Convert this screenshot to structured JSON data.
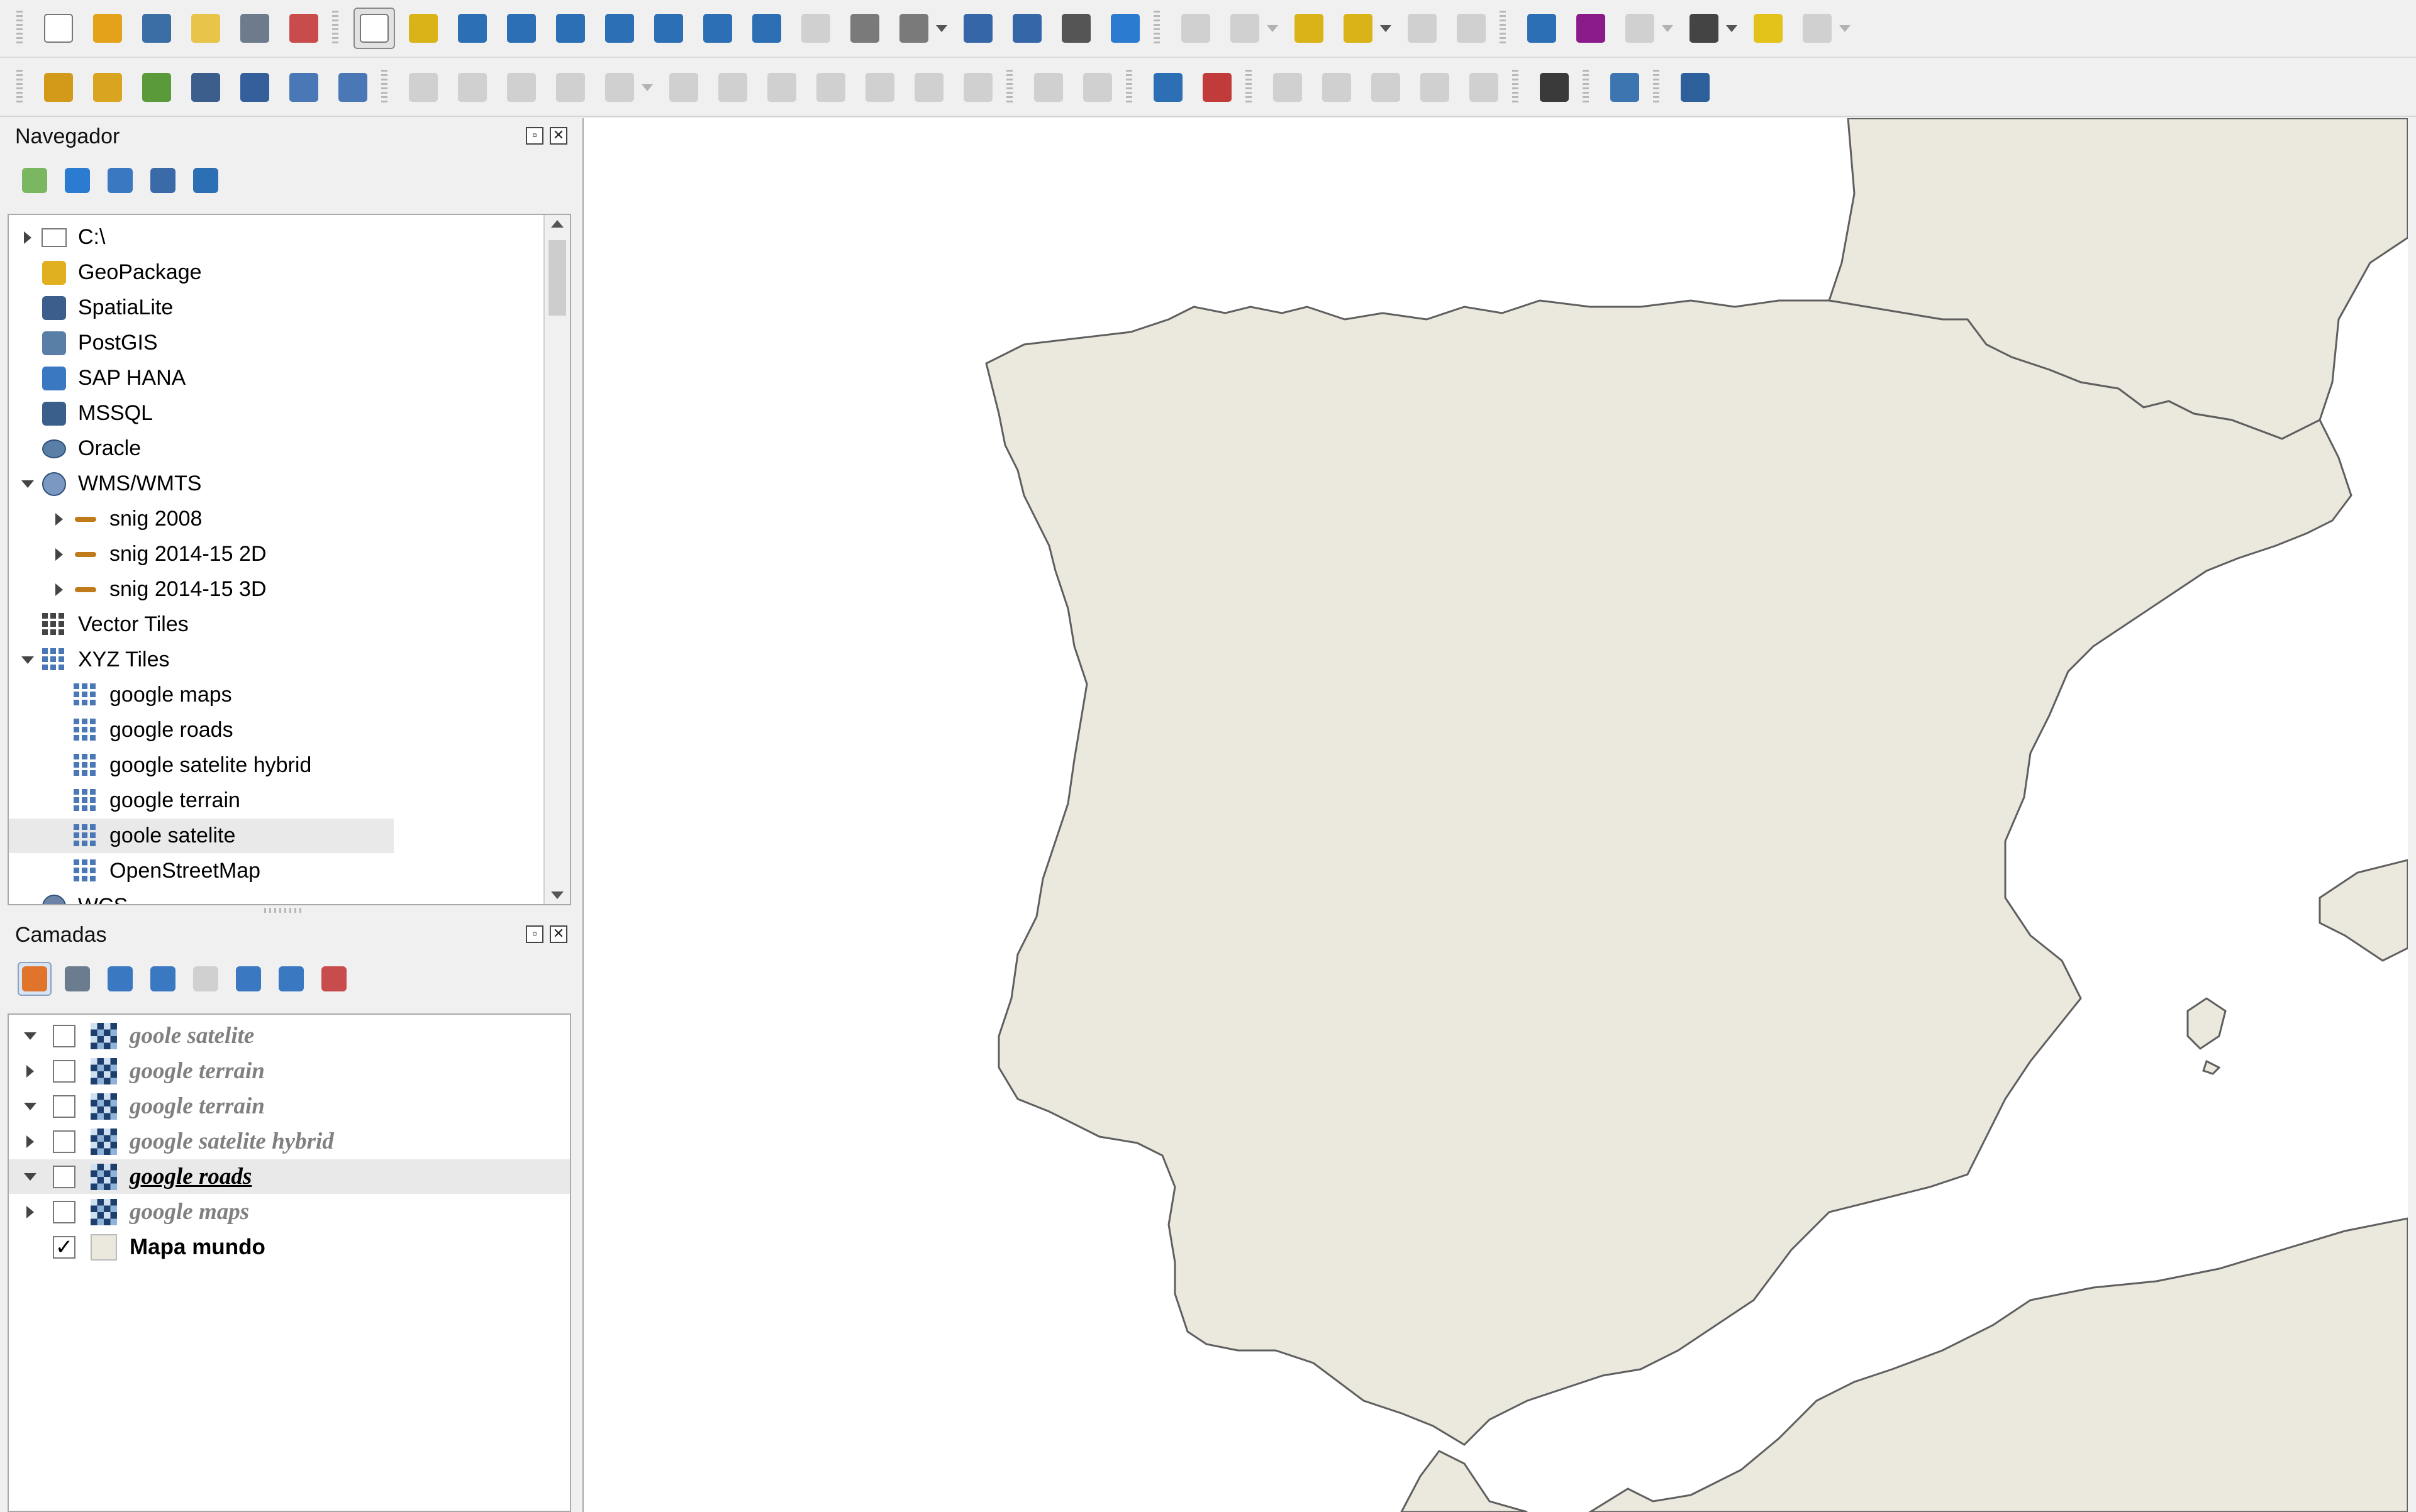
{
  "colors": {
    "land": "#ebe8dd",
    "border": "#5f5f5f",
    "sea": "#ffffff",
    "toolbar_bg": "#f0f0f0"
  },
  "toolbar1": [
    {
      "name": "new-project-icon",
      "color": "#ffffff"
    },
    {
      "name": "open-project-icon",
      "color": "#e3a21a"
    },
    {
      "name": "save-project-icon",
      "color": "#3a6ea5"
    },
    {
      "name": "new-print-layout-icon",
      "color": "#e8c44a"
    },
    {
      "name": "layout-manager-icon",
      "color": "#6d7b8d"
    },
    {
      "name": "style-manager-icon",
      "color": "#c94c4c"
    },
    {
      "name": "pan-map-icon",
      "color": "#ffffff",
      "active": true
    },
    {
      "name": "pan-to-selection-icon",
      "color": "#d9b317"
    },
    {
      "name": "zoom-in-icon",
      "color": "#2d6fb4"
    },
    {
      "name": "zoom-out-icon",
      "color": "#2d6fb4"
    },
    {
      "name": "zoom-full-icon",
      "color": "#2d6fb4"
    },
    {
      "name": "zoom-to-selection-icon",
      "color": "#2d6fb4"
    },
    {
      "name": "zoom-to-layer-icon",
      "color": "#2d6fb4"
    },
    {
      "name": "zoom-native-icon",
      "color": "#2d6fb4"
    },
    {
      "name": "zoom-last-icon",
      "color": "#2d6fb4"
    },
    {
      "name": "zoom-next-icon",
      "color": "#9a9a9a",
      "disabled": true
    },
    {
      "name": "new-map-view-icon",
      "color": "#7a7a7a"
    },
    {
      "name": "new-3d-map-view-icon",
      "color": "#7a7a7a"
    },
    {
      "name": "new-bookmark-icon",
      "color": "#3466a8"
    },
    {
      "name": "show-bookmarks-icon",
      "color": "#3466a8"
    },
    {
      "name": "temporal-controller-icon",
      "color": "#555555"
    },
    {
      "name": "refresh-icon",
      "color": "#2b7bd0"
    },
    {
      "name": "identify-features-icon",
      "color": "#9a9a9a",
      "disabled": true
    },
    {
      "name": "select-features-icon",
      "color": "#9a9a9a",
      "disabled": true
    },
    {
      "name": "select-by-value-icon",
      "color": "#d9b317"
    },
    {
      "name": "deselect-icon",
      "color": "#d9b317"
    },
    {
      "name": "locate-icon",
      "color": "#9a9a9a",
      "disabled": true
    },
    {
      "name": "attribute-table-icon",
      "color": "#9a9a9a",
      "disabled": true
    },
    {
      "name": "processing-toolbox-icon",
      "color": "#2d6fb4"
    },
    {
      "name": "statistical-summary-icon",
      "color": "#8b1a8b"
    },
    {
      "name": "field-calculator-icon",
      "color": "#9a9a9a",
      "disabled": true
    },
    {
      "name": "measure-line-icon",
      "color": "#444444"
    },
    {
      "name": "map-tips-icon",
      "color": "#e3c21a"
    },
    {
      "name": "text-annotation-icon",
      "color": "#9a9a9a",
      "disabled": true
    }
  ],
  "toolbar2": [
    {
      "name": "data-source-manager-icon",
      "color": "#d39a1a"
    },
    {
      "name": "new-geopackage-layer-icon",
      "color": "#d9a520"
    },
    {
      "name": "new-shapefile-layer-icon",
      "color": "#5a9a3b"
    },
    {
      "name": "new-spatialite-layer-icon",
      "color": "#3b5e8c"
    },
    {
      "name": "new-temporary-layer-icon",
      "color": "#355f9a"
    },
    {
      "name": "new-virtual-layer-icon",
      "color": "#4a78b6"
    },
    {
      "name": "add-vector-layer-icon",
      "color": "#4a78b6"
    },
    {
      "name": "toggle-editing-icon",
      "color": "#9a9a9a",
      "disabled": true
    },
    {
      "name": "current-edits-icon",
      "color": "#9a9a9a",
      "disabled": true
    },
    {
      "name": "save-layer-edits-icon",
      "color": "#9a9a9a",
      "disabled": true
    },
    {
      "name": "add-feature-icon",
      "color": "#9a9a9a",
      "disabled": true
    },
    {
      "name": "vertex-tool-icon",
      "color": "#9a9a9a",
      "disabled": true
    },
    {
      "name": "modify-attributes-icon",
      "color": "#9a9a9a",
      "disabled": true
    },
    {
      "name": "delete-selected-icon",
      "color": "#9a9a9a",
      "disabled": true
    },
    {
      "name": "cut-features-icon",
      "color": "#9a9a9a",
      "disabled": true
    },
    {
      "name": "copy-features-icon",
      "color": "#9a9a9a",
      "disabled": true
    },
    {
      "name": "paste-features-icon",
      "color": "#9a9a9a",
      "disabled": true
    },
    {
      "name": "undo-icon",
      "color": "#9a9a9a",
      "disabled": true
    },
    {
      "name": "redo-icon",
      "color": "#9a9a9a",
      "disabled": true
    },
    {
      "name": "label-options-icon",
      "color": "#9a9a9a",
      "disabled": true
    },
    {
      "name": "label-tool-icon",
      "color": "#9a9a9a",
      "disabled": true
    },
    {
      "name": "layer-labeling-icon",
      "color": "#2d6fb4"
    },
    {
      "name": "layer-diagram-icon",
      "color": "#c23b3b"
    },
    {
      "name": "pin-labels-icon",
      "color": "#9a9a9a",
      "disabled": true
    },
    {
      "name": "show-hide-labels-icon",
      "color": "#9a9a9a",
      "disabled": true
    },
    {
      "name": "move-label-icon",
      "color": "#9a9a9a",
      "disabled": true
    },
    {
      "name": "rotate-label-icon",
      "color": "#9a9a9a",
      "disabled": true
    },
    {
      "name": "change-label-icon",
      "color": "#9a9a9a",
      "disabled": true
    },
    {
      "name": "plugin-globe-icon",
      "color": "#3a3a3a"
    },
    {
      "name": "python-console-icon",
      "color": "#3d75b0"
    },
    {
      "name": "help-icon",
      "color": "#2d5f9a"
    }
  ],
  "navigator": {
    "title": "Navegador",
    "tools": [
      "add-selected-icon",
      "refresh-icon",
      "filter-icon",
      "collapse-all-icon",
      "properties-icon"
    ],
    "items": [
      {
        "label": "C:\\",
        "indent": 0,
        "expander": "right",
        "icon": "folder-icon"
      },
      {
        "label": "GeoPackage",
        "indent": 0,
        "expander": "",
        "icon": "geopackage-icon"
      },
      {
        "label": "SpatiaLite",
        "indent": 0,
        "expander": "",
        "icon": "spatialite-icon"
      },
      {
        "label": "PostGIS",
        "indent": 0,
        "expander": "",
        "icon": "postgis-icon"
      },
      {
        "label": "SAP HANA",
        "indent": 0,
        "expander": "",
        "icon": "sap-hana-icon"
      },
      {
        "label": "MSSQL",
        "indent": 0,
        "expander": "",
        "icon": "mssql-icon"
      },
      {
        "label": "Oracle",
        "indent": 0,
        "expander": "",
        "icon": "oracle-icon"
      },
      {
        "label": "WMS/WMTS",
        "indent": 0,
        "expander": "down",
        "icon": "wms-globe-icon"
      },
      {
        "label": "snig 2008",
        "indent": 1,
        "expander": "right",
        "icon": "wms-connection-icon"
      },
      {
        "label": "snig 2014-15 2D",
        "indent": 1,
        "expander": "right",
        "icon": "wms-connection-icon"
      },
      {
        "label": "snig 2014-15 3D",
        "indent": 1,
        "expander": "right",
        "icon": "wms-connection-icon"
      },
      {
        "label": "Vector Tiles",
        "indent": 0,
        "expander": "",
        "icon": "vector-tiles-icon"
      },
      {
        "label": "XYZ Tiles",
        "indent": 0,
        "expander": "down",
        "icon": "xyz-tiles-icon"
      },
      {
        "label": "google maps",
        "indent": 1,
        "expander": "",
        "icon": "xyz-layer-icon"
      },
      {
        "label": "google roads",
        "indent": 1,
        "expander": "",
        "icon": "xyz-layer-icon"
      },
      {
        "label": "google satelite hybrid",
        "indent": 1,
        "expander": "",
        "icon": "xyz-layer-icon"
      },
      {
        "label": "google terrain",
        "indent": 1,
        "expander": "",
        "icon": "xyz-layer-icon"
      },
      {
        "label": "goole satelite",
        "indent": 1,
        "expander": "",
        "icon": "xyz-layer-icon",
        "selected": true
      },
      {
        "label": "OpenStreetMap",
        "indent": 1,
        "expander": "",
        "icon": "xyz-layer-icon"
      },
      {
        "label": "WCS",
        "indent": 0,
        "expander": "",
        "icon": "wcs-globe-icon"
      }
    ]
  },
  "layers": {
    "title": "Camadas",
    "tools": [
      "open-layer-styling-icon",
      "add-group-icon",
      "manage-visibility-icon",
      "filter-legend-icon",
      "filter-by-expression-icon",
      "expand-all-icon",
      "collapse-all-icon",
      "remove-layer-icon"
    ],
    "items": [
      {
        "label": "goole satelite",
        "expander": "down",
        "checked": false,
        "type": "raster"
      },
      {
        "label": "google terrain",
        "expander": "right",
        "checked": false,
        "type": "raster"
      },
      {
        "label": "google terrain",
        "expander": "down",
        "checked": false,
        "type": "raster"
      },
      {
        "label": "google satelite hybrid",
        "expander": "right",
        "checked": false,
        "type": "raster"
      },
      {
        "label": "google roads",
        "expander": "down",
        "checked": false,
        "type": "raster",
        "current": true
      },
      {
        "label": "google maps",
        "expander": "right",
        "checked": false,
        "type": "raster"
      },
      {
        "label": "Mapa mundo",
        "expander": "",
        "checked": true,
        "type": "polygon"
      }
    ],
    "checkmark": "✓"
  }
}
